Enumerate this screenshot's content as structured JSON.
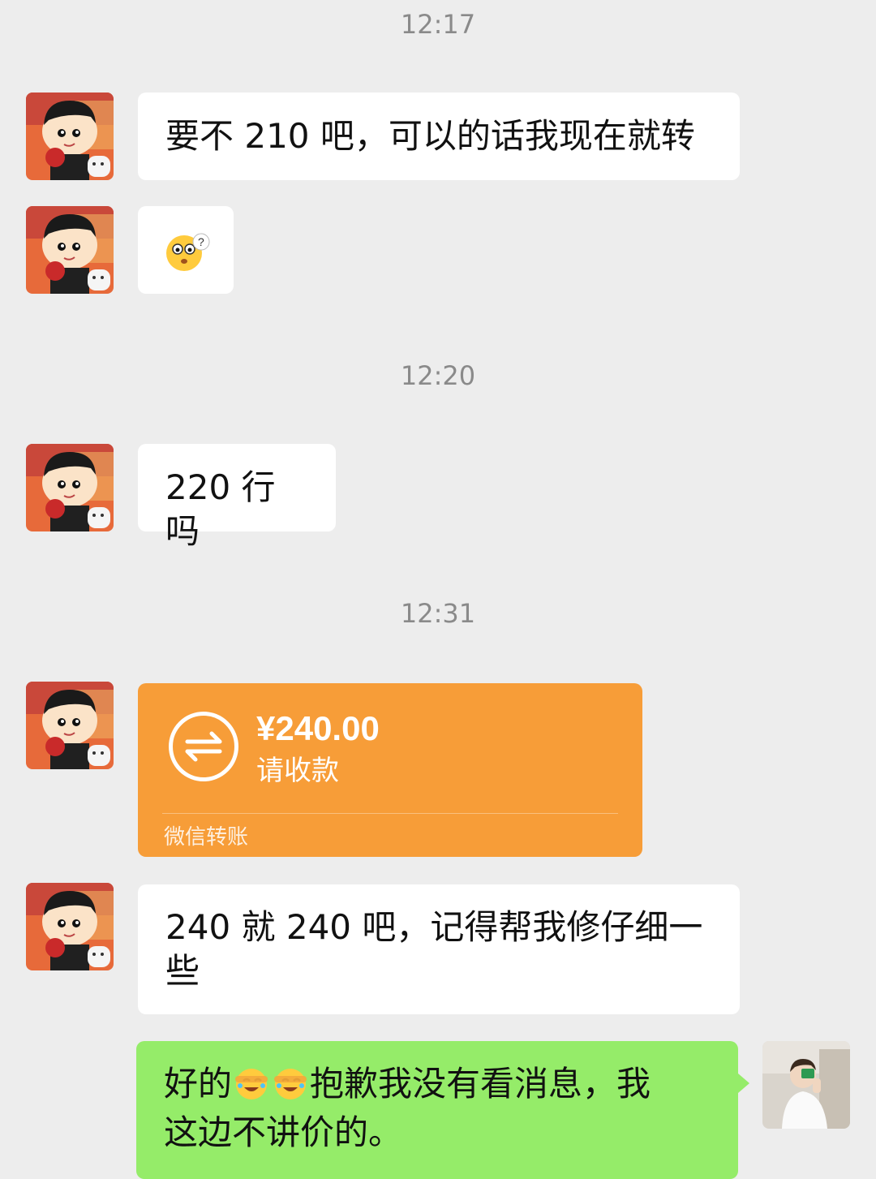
{
  "colors": {
    "background": "#ededed",
    "bubble_white": "#ffffff",
    "bubble_green": "#95ec69",
    "transfer_orange": "#f79d38",
    "timestamp_gray": "#8a8a8a"
  },
  "timestamps": [
    "12:17",
    "12:20",
    "12:31"
  ],
  "messages": {
    "m1": {
      "text": "要不 210 吧，可以的话我现在就转"
    },
    "m2": {
      "sticker": "confused-face-emoji"
    },
    "m3": {
      "text": "220 行吗"
    },
    "transfer": {
      "amount": "¥240.00",
      "status": "请收款",
      "footer": "微信转账",
      "icon": "transfer-arrows-icon"
    },
    "m5": {
      "line1": "240 就 240 吧，记得帮我修仔细一",
      "line2": "些"
    },
    "m6": {
      "part1": "好的",
      "emoji": "facepalm-laugh-emoji",
      "part2": "抱歉我没有看消息，我",
      "line2": "这边不讲价的。"
    }
  }
}
